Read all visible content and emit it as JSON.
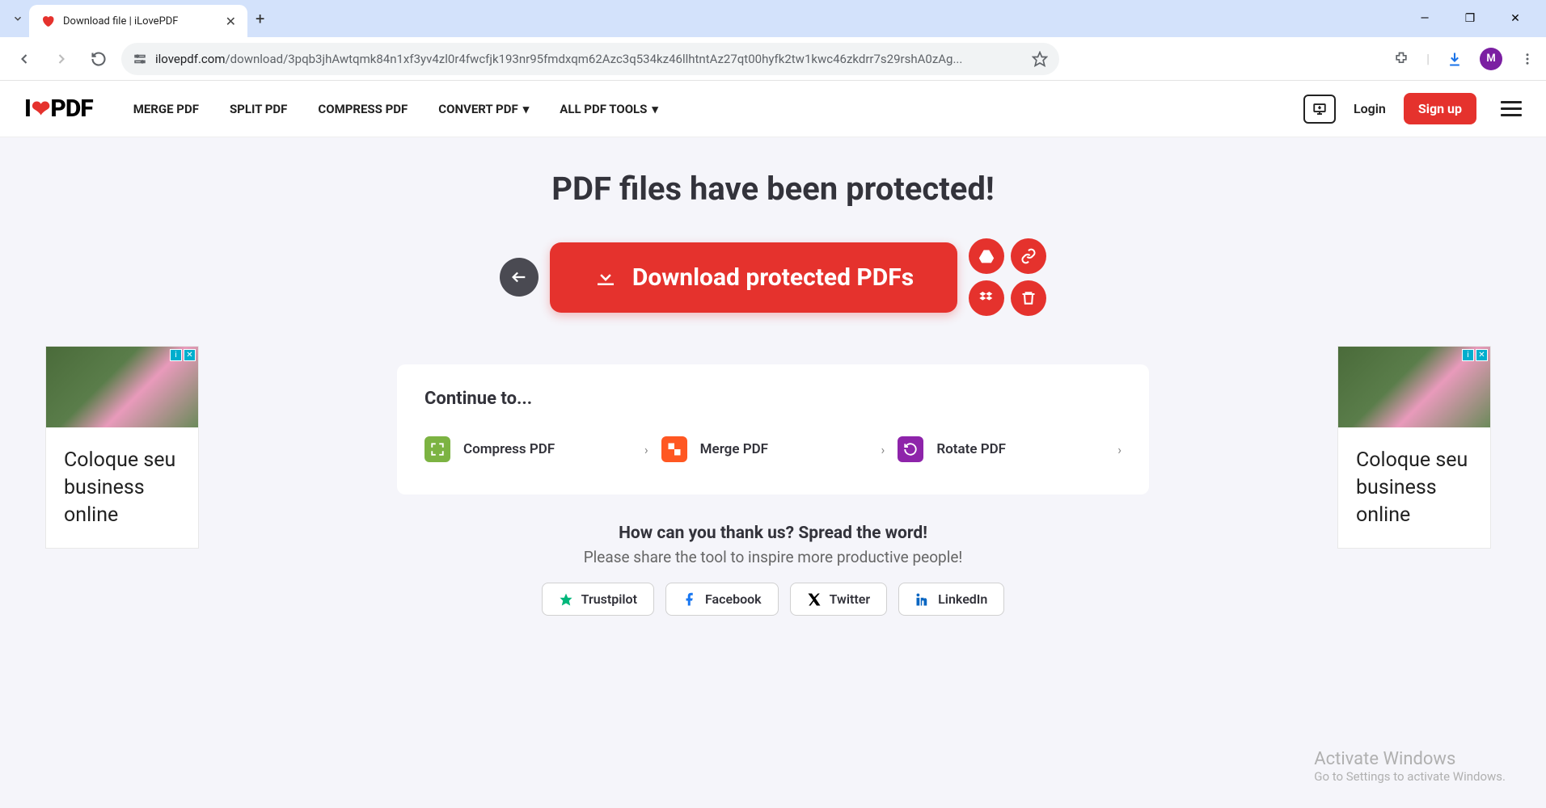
{
  "browser": {
    "tab_title": "Download file | iLovePDF",
    "url_host": "ilovepdf.com",
    "url_path": "/download/3pqb3jhAwtqmk84n1xf3yv4zl0r4fwcfjk193nr95fmdxqm62Azc3q534kz46llhtntAz27qt00hyfk2tw1kwc46zkdrr7s29rshA0zAg...",
    "avatar_letter": "M"
  },
  "header": {
    "nav": {
      "merge": "MERGE PDF",
      "split": "SPLIT PDF",
      "compress": "COMPRESS PDF",
      "convert": "CONVERT PDF",
      "all": "ALL PDF TOOLS"
    },
    "login": "Login",
    "signup": "Sign up"
  },
  "main": {
    "title": "PDF files have been protected!",
    "download_label": "Download protected PDFs",
    "continue_title": "Continue to...",
    "continue_items": {
      "compress": "Compress PDF",
      "merge": "Merge PDF",
      "rotate": "Rotate PDF"
    },
    "thank_heading": "How can you thank us? Spread the word!",
    "thank_sub": "Please share the tool to inspire more productive people!",
    "share": {
      "trustpilot": "Trustpilot",
      "facebook": "Facebook",
      "twitter": "Twitter",
      "linkedin": "LinkedIn"
    }
  },
  "ad": {
    "text": "Coloque seu business online"
  },
  "activate": {
    "line1": "Activate Windows",
    "line2": "Go to Settings to activate Windows."
  }
}
